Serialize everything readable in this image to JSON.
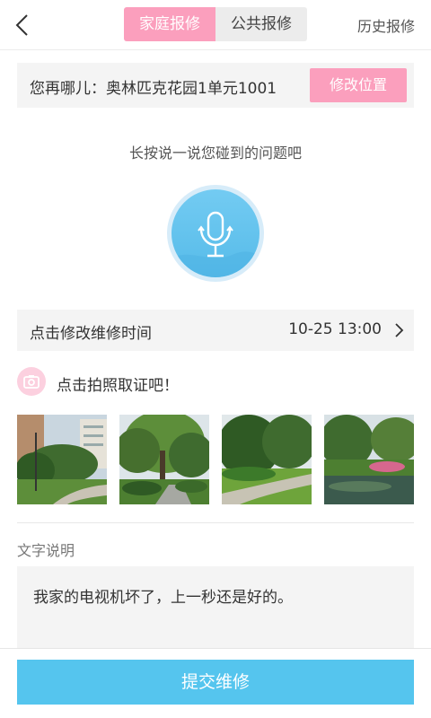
{
  "header": {
    "back_icon": "chevron-left-icon",
    "tabs": [
      {
        "label": "家庭报修",
        "active": true
      },
      {
        "label": "公共报修",
        "active": false
      }
    ],
    "history_label": "历史报修",
    "accent_color": "#fb9fbd"
  },
  "location": {
    "label": "您再哪儿：奥林匹克花园1单元1001",
    "change_button": "修改位置"
  },
  "voice": {
    "hint": "长按说一说您碰到的问题吧",
    "icon": "microphone-icon",
    "color": "#56bbe9"
  },
  "repair_time": {
    "label": "点击修改维修时间",
    "value": "10-25 13:00",
    "icon": "chevron-right-icon"
  },
  "photo": {
    "label": "点击拍照取证吧！",
    "icon": "camera-icon",
    "thumbnails": [
      {
        "name": "garden-photo-1"
      },
      {
        "name": "garden-photo-2"
      },
      {
        "name": "garden-photo-3"
      },
      {
        "name": "garden-photo-4"
      }
    ]
  },
  "description": {
    "label": "文字说明",
    "value": "我家的电视机坏了，上一秒还是好的。"
  },
  "submit": {
    "label": "提交维修",
    "color": "#55c5ee"
  }
}
